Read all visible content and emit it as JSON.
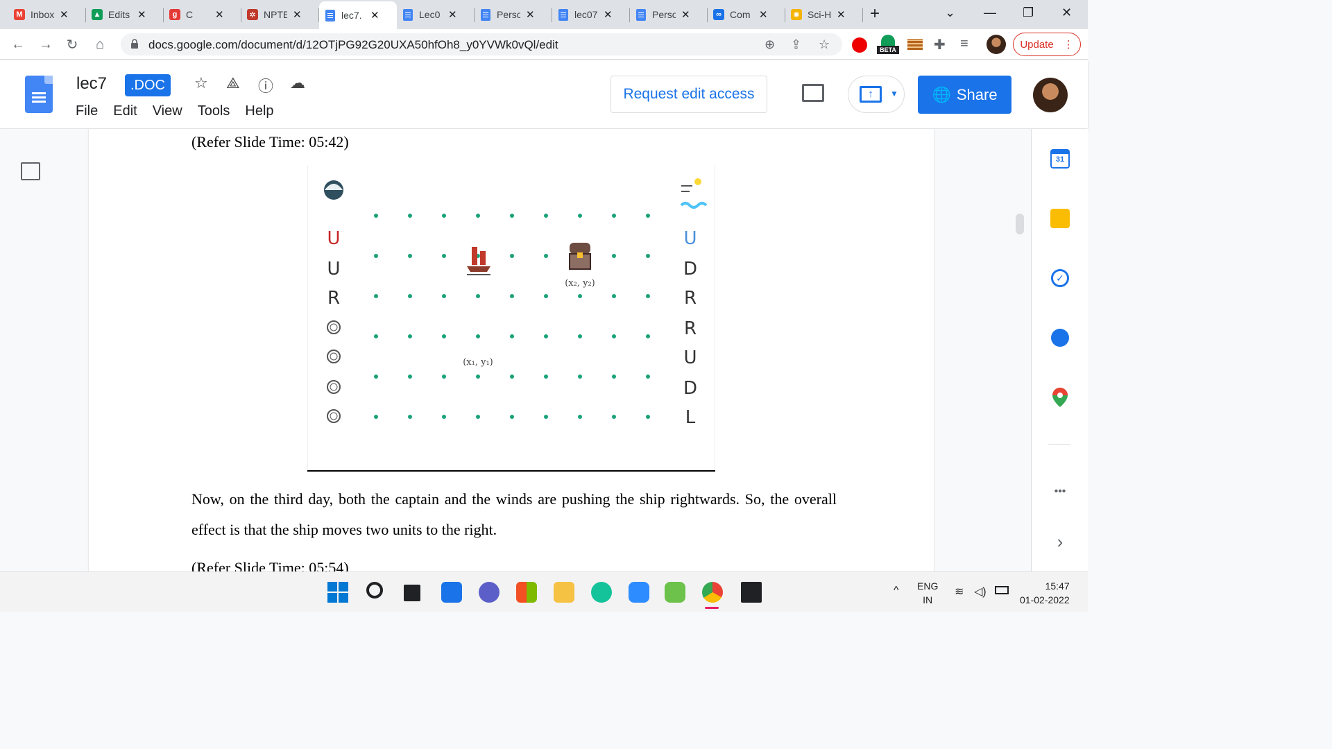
{
  "browser": {
    "tabs": [
      {
        "label": "Inbox",
        "fav": "M",
        "favcolor": "#ea4335"
      },
      {
        "label": "Edits",
        "fav": "▲",
        "favcolor": "#0f9d58"
      },
      {
        "label": "C",
        "fav": "g",
        "favcolor": "#e53935"
      },
      {
        "label": "NPTE",
        "fav": "✲",
        "favcolor": "#c0392b"
      },
      {
        "label": "lec7.",
        "fav": "doc",
        "favcolor": "#4285f4",
        "active": true
      },
      {
        "label": "Lec0",
        "fav": "doc",
        "favcolor": "#4285f4"
      },
      {
        "label": "Perso",
        "fav": "doc",
        "favcolor": "#4285f4"
      },
      {
        "label": "lec07",
        "fav": "doc",
        "favcolor": "#4285f4"
      },
      {
        "label": "Perso",
        "fav": "doc",
        "favcolor": "#4285f4"
      },
      {
        "label": "Com",
        "fav": "∞",
        "favcolor": "#1a73e8"
      },
      {
        "label": "Sci-H",
        "fav": "✺",
        "favcolor": "#f4b400"
      }
    ],
    "new_tab": "+",
    "url": "docs.google.com/document/d/12OTjPG92G20UXA50hfOh8_y0YVWk0vQl/edit",
    "update_label": "Update",
    "beta_label": "BETA"
  },
  "docs": {
    "title": "lec7",
    "badge": ".DOC",
    "menus": [
      "File",
      "Edit",
      "View",
      "Tools",
      "Help"
    ],
    "request_edit": "Request edit access",
    "share": "Share"
  },
  "document": {
    "slide_time_1": "(Refer Slide Time: 05:42)",
    "paragraph": "Now, on the third day, both the captain and the winds are pushing the ship rightwards. So, the overall effect is that the ship moves two units to the right.",
    "slide_time_2": "(Refer Slide Time: 05:54)",
    "slide": {
      "left_column": [
        "U",
        "U",
        "R",
        "coin",
        "coin",
        "coin",
        "coin"
      ],
      "right_column": [
        "U",
        "D",
        "R",
        "R",
        "U",
        "D",
        "L"
      ],
      "label_start": "(x₁, y₁)",
      "label_end": "(x₂, y₂)",
      "dot_color": "#1aa37a",
      "highlight_color": "#c62828",
      "highlight_right_color": "#4a90d9"
    }
  },
  "sidebar": {
    "calendar_day": "31",
    "more": "•••",
    "expand": "›"
  },
  "taskbar": {
    "lang_1": "ENG",
    "lang_2": "IN",
    "time": "15:47",
    "date": "01-02-2022"
  }
}
